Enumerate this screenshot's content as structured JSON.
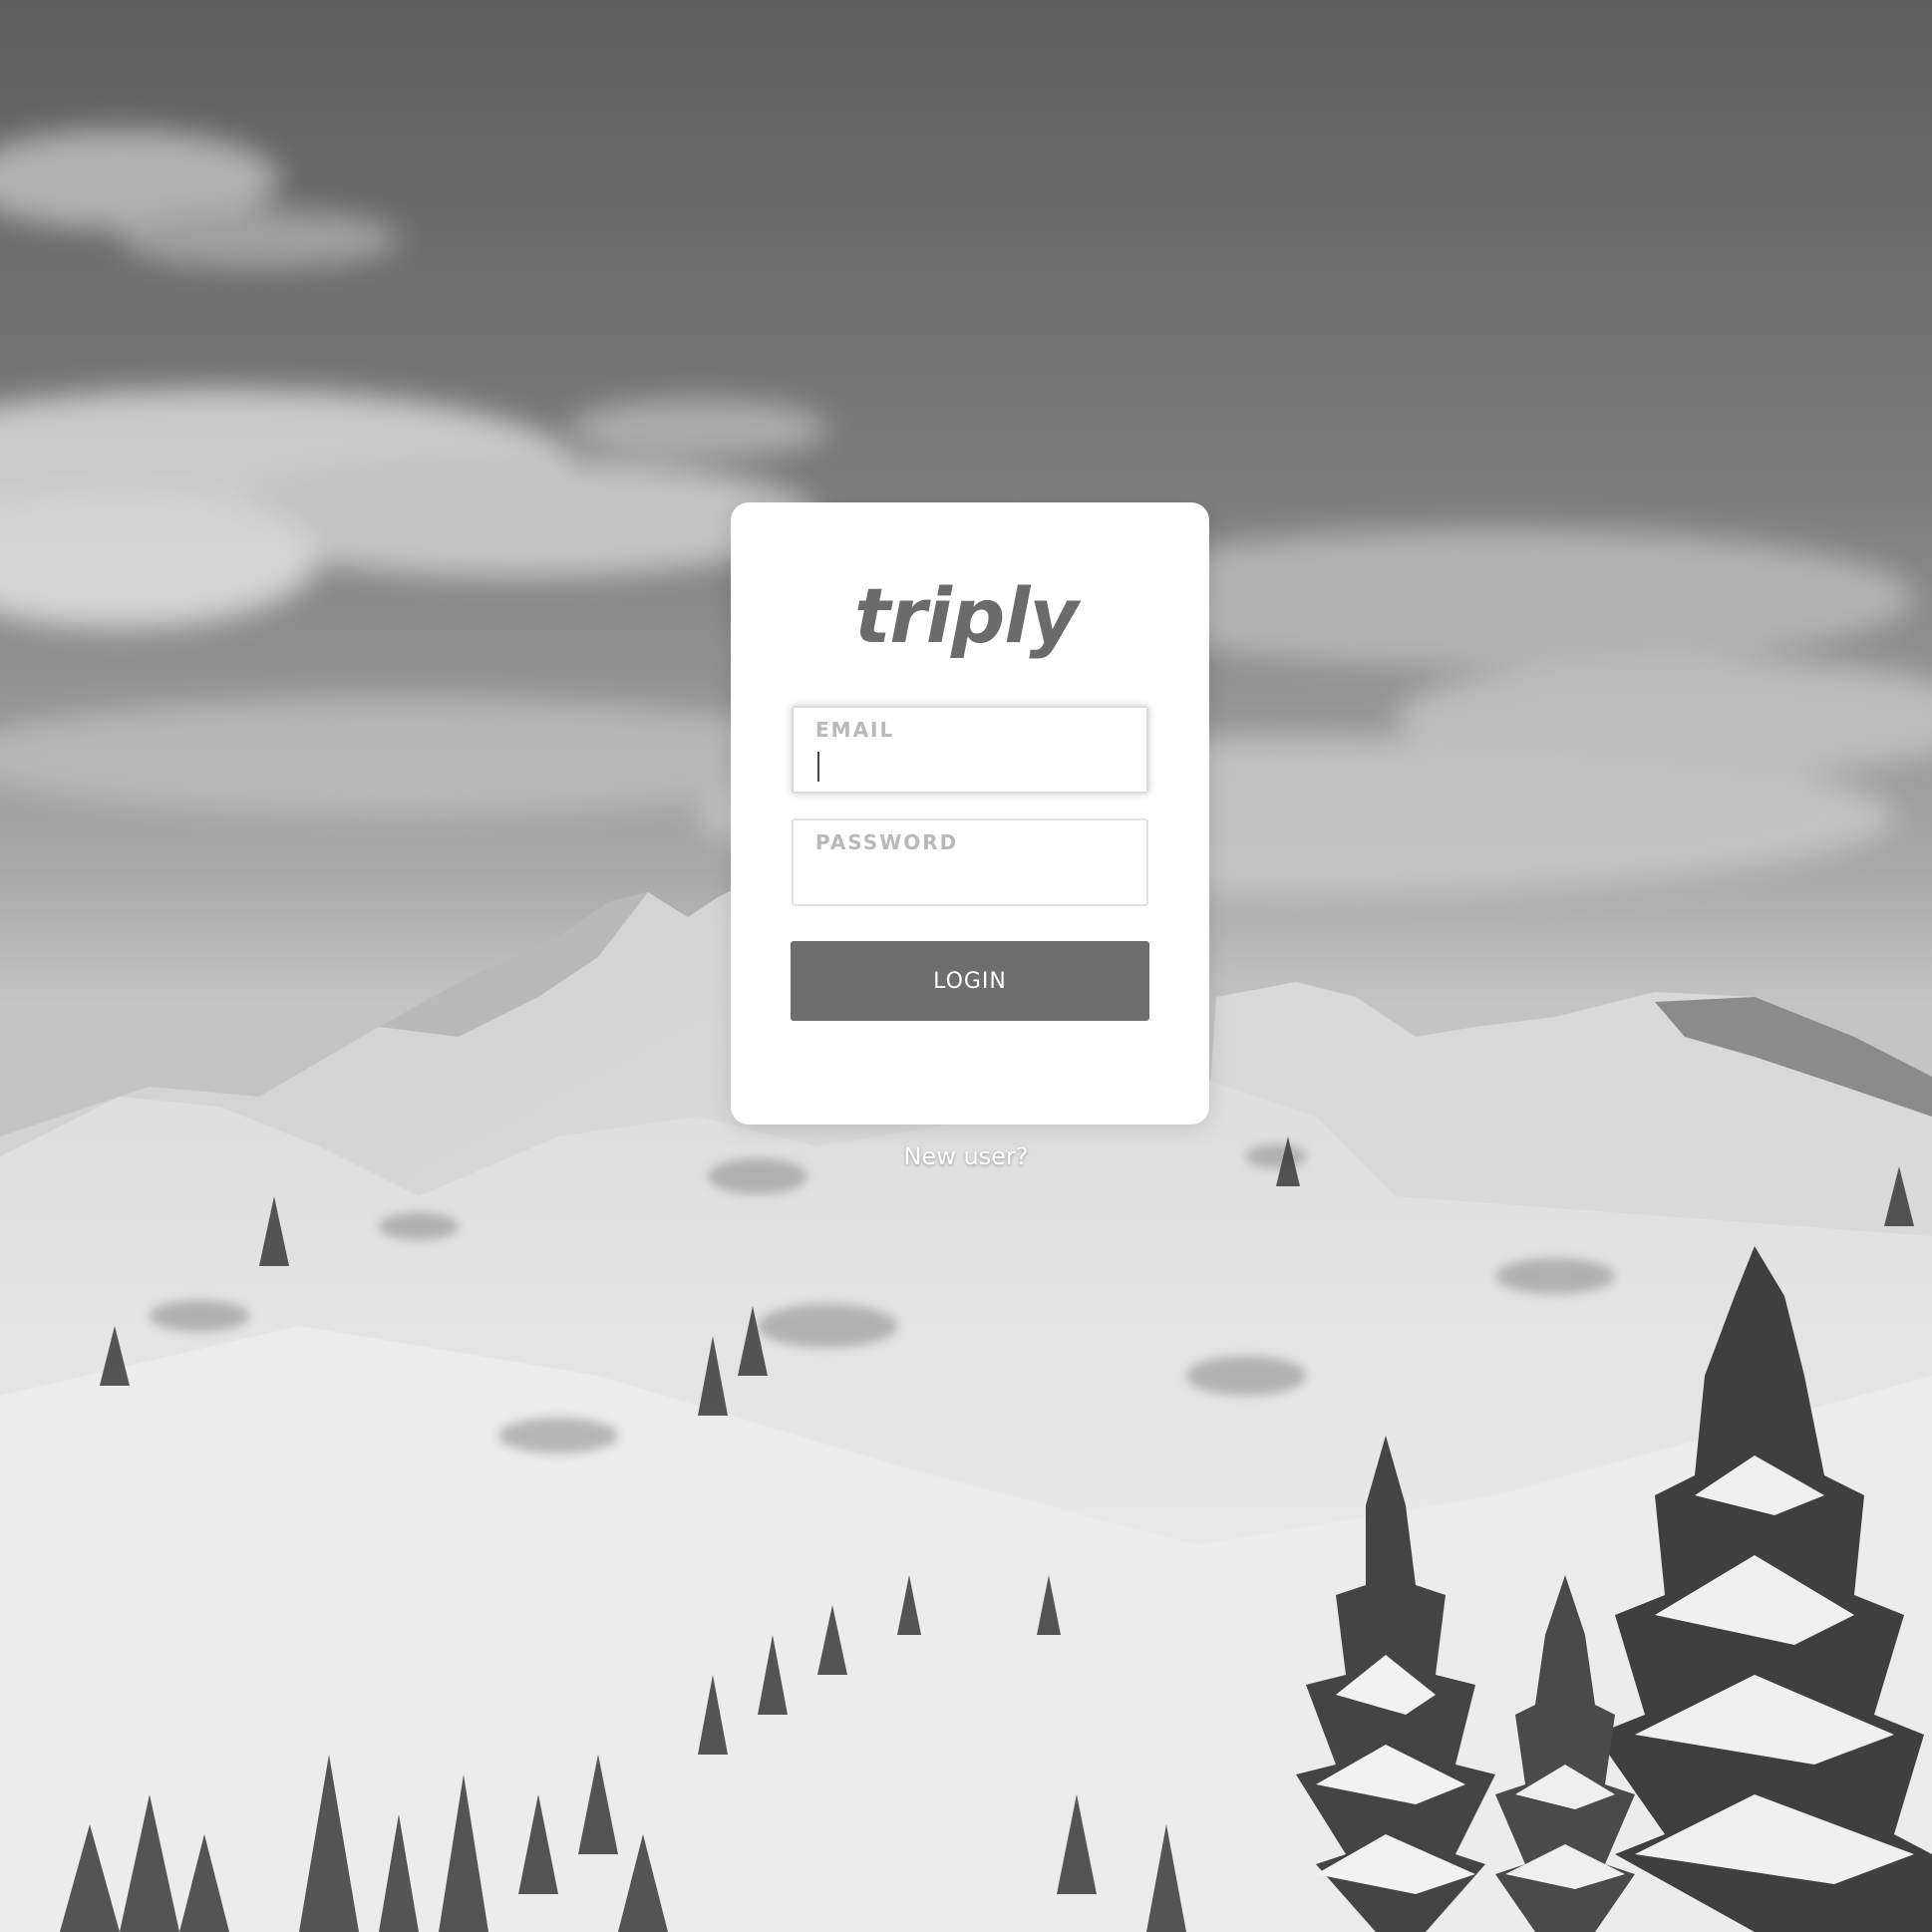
{
  "app": {
    "logo_text": "triply"
  },
  "login_form": {
    "email": {
      "label": "EMAIL",
      "value": ""
    },
    "password": {
      "label": "PASSWORD",
      "value": ""
    },
    "login_button_label": "LOGIN"
  },
  "footer": {
    "new_user_link": "New user?"
  },
  "colors": {
    "button": "#6e6e6e",
    "logo": "#6b6b6b",
    "label": "#b9b9b9",
    "card": "#ffffff"
  }
}
